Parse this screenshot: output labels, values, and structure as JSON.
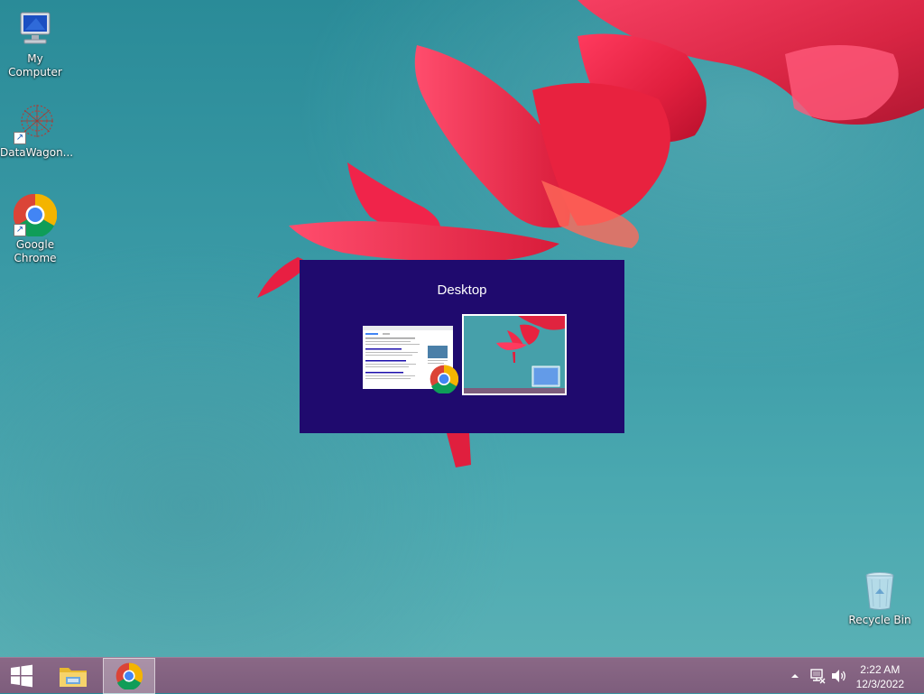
{
  "desktop_icons": {
    "my_computer": "My Computer",
    "datawagon": "DataWagon...",
    "chrome": "Google Chrome",
    "recycle_bin": "Recycle Bin"
  },
  "switcher": {
    "title": "Desktop",
    "selected": "desktop"
  },
  "taskbar": {
    "pinned": [
      "start-button",
      "file-explorer",
      "google-chrome"
    ],
    "active": "google-chrome"
  },
  "tray": {
    "time": "2:22 AM",
    "date": "12/3/2022",
    "icons": [
      "show-hidden-icons",
      "network-icon",
      "volume-icon"
    ]
  },
  "colors": {
    "switcher_bg": "#1f0a6e",
    "taskbar_bg": "#7d5d7c"
  }
}
